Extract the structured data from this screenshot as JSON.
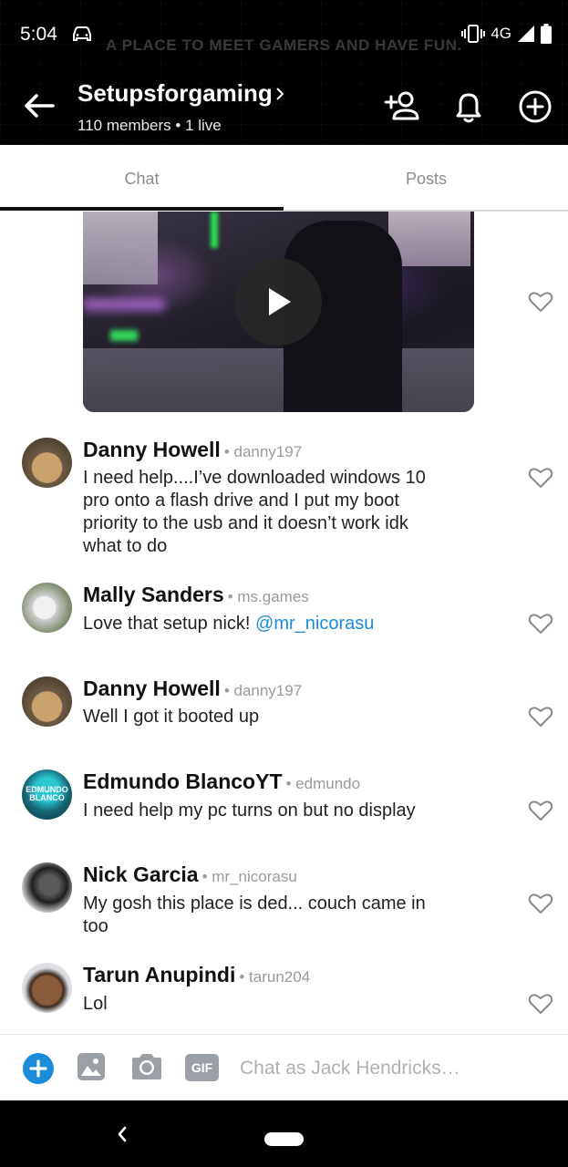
{
  "status_bar": {
    "time": "5:04",
    "network": "4G"
  },
  "banner_text": "A PLACE TO MEET GAMERS AND HAVE FUN.",
  "group": {
    "title": "Setupsforgaming",
    "subtitle": "110 members • 1 live"
  },
  "tabs": [
    {
      "label": "Chat",
      "active": true
    },
    {
      "label": "Posts",
      "active": false
    }
  ],
  "messages": [
    {
      "name": "Danny Howell",
      "handle": "• danny197",
      "lines": [
        "I need help....I’ve downloaded windows 10",
        "pro onto a flash drive and I put my boot",
        "priority to the usb and it doesn’t work idk",
        "what to do"
      ]
    },
    {
      "name": "Mally Sanders",
      "handle": "• ms.games",
      "text": "Love that setup nick! ",
      "mention": "@mr_nicorasu"
    },
    {
      "name": "Danny Howell",
      "handle": "• danny197",
      "text": "Well I got it booted up"
    },
    {
      "name": "Edmundo BlancoYT",
      "handle": "• edmundo",
      "text": "I need help my pc turns on but no display",
      "avatar_text_1": "EDMUNDO",
      "avatar_text_2": "BLANCO"
    },
    {
      "name": "Nick Garcia",
      "handle": "• mr_nicorasu",
      "lines": [
        "My gosh this place is ded... couch came in",
        "too"
      ]
    },
    {
      "name": "Tarun Anupindi",
      "handle": "• tarun204",
      "text": "Lol"
    }
  ],
  "composer": {
    "gif_label": "GIF",
    "placeholder": "Chat as Jack Hendricks…"
  },
  "colors": {
    "accent": "#1a8cd8",
    "header_bg": "#000000",
    "mention": "#1a8cd8"
  },
  "icons": [
    "back-arrow-icon",
    "add-member-icon",
    "bell-icon",
    "add-circle-icon",
    "play-icon",
    "heart-icon",
    "plus-icon",
    "image-icon",
    "camera-icon"
  ]
}
